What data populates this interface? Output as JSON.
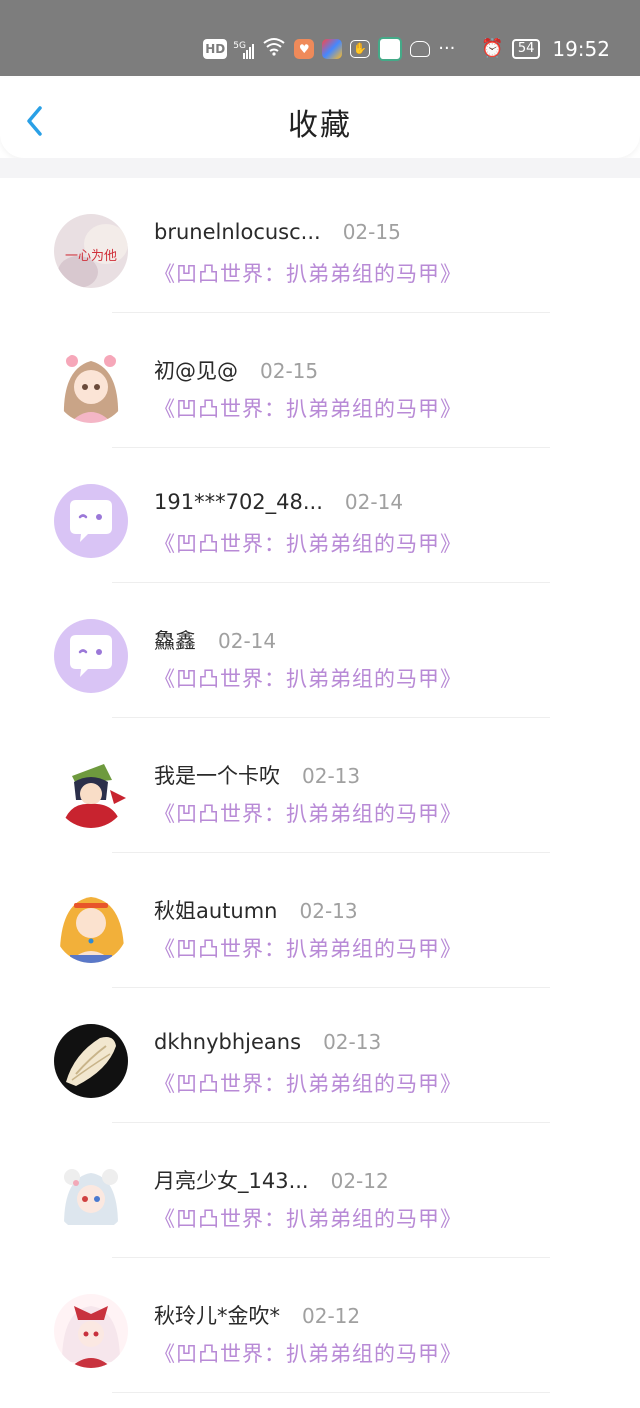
{
  "status_bar": {
    "hd": "HD",
    "network": "5G",
    "battery": "54",
    "time": "19:52",
    "icons": [
      "hd-icon",
      "signal-icon",
      "wifi-icon",
      "health-app-icon",
      "app-icon",
      "hand-icon",
      "app-icon",
      "robot-icon",
      "more-dots-icon",
      "alarm-icon",
      "battery-icon"
    ]
  },
  "header": {
    "title": "收藏",
    "back_icon": "chevron-left-icon"
  },
  "colors": {
    "accent_blue": "#2aa0e6",
    "work_purple": "#b88ad6",
    "status_gray": "#7d7d7d"
  },
  "favorites": [
    {
      "username": "brunelnlocusc...",
      "date": "02-15",
      "work": "《凹凸世界：扒弟弟组的马甲》",
      "avatar": "avatar-photo-text",
      "avatar_text": "一心为他"
    },
    {
      "username": "初@见@",
      "date": "02-15",
      "work": "《凹凸世界：扒弟弟组的马甲》",
      "avatar": "avatar-anime-girl-pink"
    },
    {
      "username": "191***702_48...",
      "date": "02-14",
      "work": "《凹凸世界：扒弟弟组的马甲》",
      "avatar": "avatar-default-chat"
    },
    {
      "username": "鱻鑫",
      "date": "02-14",
      "work": "《凹凸世界：扒弟弟组的马甲》",
      "avatar": "avatar-default-chat"
    },
    {
      "username": "我是一个卡吹",
      "date": "02-13",
      "work": "《凹凸世界：扒弟弟组的马甲》",
      "avatar": "avatar-anime-boy-green"
    },
    {
      "username": "秋姐autumn",
      "date": "02-13",
      "work": "《凹凸世界：扒弟弟组的马甲》",
      "avatar": "avatar-anime-girl-blonde"
    },
    {
      "username": "dkhnybhjeans",
      "date": "02-13",
      "work": "《凹凸世界：扒弟弟组的马甲》",
      "avatar": "avatar-shell"
    },
    {
      "username": "月亮少女_143...",
      "date": "02-12",
      "work": "《凹凸世界：扒弟弟组的马甲》",
      "avatar": "avatar-anime-girl-white"
    },
    {
      "username": "秋玲儿*金吹*",
      "date": "02-12",
      "work": "《凹凸世界：扒弟弟组的马甲》",
      "avatar": "avatar-anime-girl-red"
    }
  ]
}
